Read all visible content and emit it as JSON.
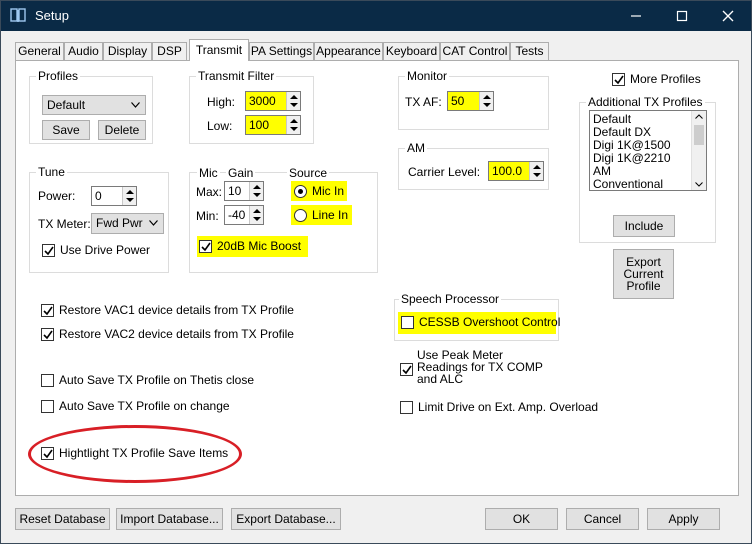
{
  "window": {
    "title": "Setup"
  },
  "tabs": [
    "General",
    "Audio",
    "Display",
    "DSP",
    "Transmit",
    "PA Settings",
    "Appearance",
    "Keyboard",
    "CAT Control",
    "Tests"
  ],
  "profiles": {
    "title": "Profiles",
    "selected": "Default",
    "save": "Save",
    "delete": "Delete"
  },
  "transmit_filter": {
    "title": "Transmit Filter",
    "high_label": "High:",
    "high_value": "3000",
    "low_label": "Low:",
    "low_value": "100"
  },
  "monitor": {
    "title": "Monitor",
    "txaf_label": "TX AF:",
    "txaf_value": "50"
  },
  "more_profiles": {
    "label": "More Profiles"
  },
  "additional": {
    "title": "Additional TX Profiles",
    "items": [
      "Default",
      "Default DX",
      "Digi 1K@1500",
      "Digi 1K@2210",
      "AM",
      "Conventional"
    ],
    "include": "Include"
  },
  "export_profile": {
    "line1": "Export",
    "line2": "Current",
    "line3": "Profile"
  },
  "am": {
    "title": "AM",
    "carrier_label": "Carrier Level:",
    "carrier_value": "100.0"
  },
  "tune": {
    "title": "Tune",
    "power_label": "Power:",
    "power_value": "0",
    "meter_label": "TX Meter:",
    "meter_value": "Fwd Pwr",
    "drive_power": "Use Drive Power"
  },
  "mic": {
    "mic_label": "Mic",
    "gain_label": "Gain",
    "source_label": "Source",
    "max_label": "Max:",
    "max_value": "10",
    "min_label": "Min:",
    "min_value": "-40",
    "mic_in": "Mic In",
    "line_in": "Line In",
    "boost": "20dB Mic Boost"
  },
  "vac": {
    "vac1": "Restore VAC1 device details from TX Profile",
    "vac2": "Restore VAC2 device details from TX Profile"
  },
  "speech": {
    "title": "Speech Processor",
    "cessb": "CESSB Overshoot Control"
  },
  "autosave": {
    "on_close": "Auto Save TX Profile on Thetis close",
    "on_change": "Auto Save TX Profile on change"
  },
  "peak_meter": {
    "line1": "Use Peak Meter",
    "line2": "Readings for TX COMP",
    "line3": "and ALC"
  },
  "limit_drive": "Limit Drive on Ext. Amp. Overload",
  "highlight": "Hightlight TX Profile Save Items",
  "footer": {
    "reset": "Reset Database",
    "import": "Import Database...",
    "export": "Export Database...",
    "ok": "OK",
    "cancel": "Cancel",
    "apply": "Apply"
  },
  "colors": {
    "highlight": "#ffff00",
    "annotation": "#d81f26",
    "titlebar": "#0a2a46"
  }
}
